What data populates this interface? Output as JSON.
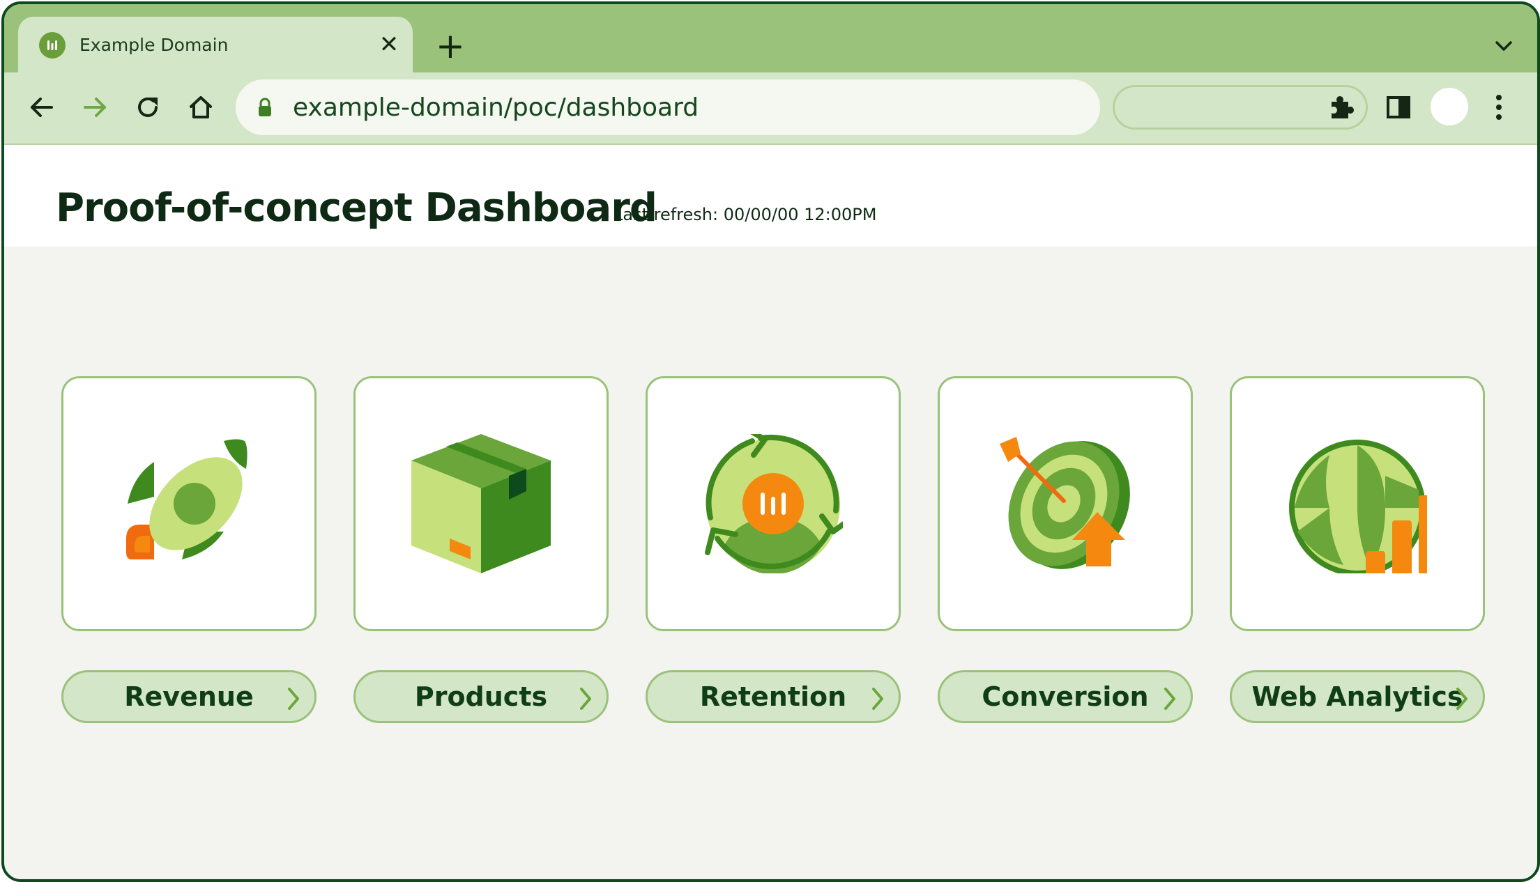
{
  "browser": {
    "tab_title": "Example Domain",
    "close_glyph": "✕",
    "new_tab_glyph": "+",
    "url": "example-domain/poc/dashboard"
  },
  "page": {
    "title": "Proof-of-concept Dashboard",
    "last_refresh": "Last refresh: 00/00/00 12:00PM"
  },
  "cards": [
    {
      "label": "Revenue",
      "icon": "rocket-icon"
    },
    {
      "label": "Products",
      "icon": "box-icon"
    },
    {
      "label": "Retention",
      "icon": "retention-cycle-icon"
    },
    {
      "label": "Conversion",
      "icon": "target-icon"
    },
    {
      "label": "Web Analytics",
      "icon": "globe-analytics-icon"
    }
  ],
  "colors": {
    "dark_green": "#0d4a1c",
    "tab_strip": "#9ac27a",
    "toolbar": "#d4e6c8",
    "accent_orange": "#f5890f",
    "page_bg": "#f3f3ef"
  }
}
